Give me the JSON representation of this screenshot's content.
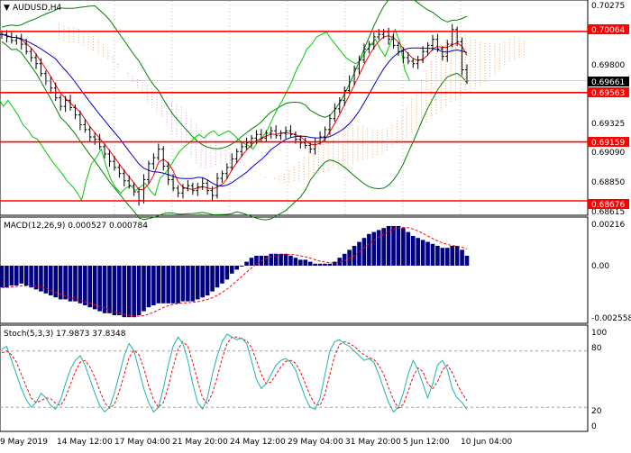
{
  "window": {
    "symbol_title": "AUDUSD,H4",
    "menu_arrow": "▼"
  },
  "colors": {
    "hline": "#ff0000",
    "price_bar": "#000000",
    "ma_fast": "#ff0000",
    "ma_slow": "#0000cc",
    "bollinger": "#008000",
    "cloud_a": "#f4a460",
    "cloud_b": "#d8a0e0",
    "chikou": "#00cc00",
    "macd_hist": "#000080",
    "macd_signal": "#ff0000",
    "stoch_main": "#20b2aa",
    "stoch_signal": "#ff0000",
    "grid": "#c0c0c0"
  },
  "price_panel": {
    "axis_labels": [
      "0.70275",
      "0.69800",
      "0.69325",
      "0.69090",
      "0.68850",
      "0.68615"
    ],
    "levels": [
      {
        "label": "0.70064",
        "value": 0.70064
      },
      {
        "label": "0.69563",
        "value": 0.69563
      },
      {
        "label": "0.69159",
        "value": 0.69159
      },
      {
        "label": "0.68676",
        "value": 0.68676
      }
    ],
    "current": {
      "label": "0.69661",
      "value": 0.69661
    }
  },
  "macd_panel": {
    "title": "MACD(12,26,9) 0.000527 0.000784",
    "axis_labels": [
      "0.00216",
      "0.00",
      "-0.002558"
    ]
  },
  "stoch_panel": {
    "title": "Stoch(5,3,3) 17.9873 37.8348",
    "axis_labels": [
      "100",
      "80",
      "20",
      "0"
    ]
  },
  "time_axis": {
    "labels": [
      "9 May 2019",
      "14 May 12:00",
      "17 May 04:00",
      "21 May 20:00",
      "24 May 12:00",
      "29 May 04:00",
      "31 May 20:00",
      "5 Jun 12:00",
      "10 Jun 04:00"
    ]
  },
  "chart_data": {
    "type": "candlestick",
    "title": "AUDUSD,H4",
    "y_range": [
      0.6858,
      0.703
    ],
    "close_series": [
      0.7004,
      0.7002,
      0.6999,
      0.7001,
      0.6996,
      0.699,
      0.6985,
      0.698,
      0.6972,
      0.6966,
      0.696,
      0.6952,
      0.6945,
      0.695,
      0.6944,
      0.6938,
      0.693,
      0.6926,
      0.692,
      0.6918,
      0.6912,
      0.6906,
      0.69,
      0.6895,
      0.689,
      0.6884,
      0.688,
      0.6875,
      0.6868,
      0.6885,
      0.6898,
      0.6903,
      0.691,
      0.6896,
      0.6885,
      0.6878,
      0.6874,
      0.6878,
      0.688,
      0.6876,
      0.6879,
      0.6882,
      0.6876,
      0.6872,
      0.6886,
      0.689,
      0.6895,
      0.6902,
      0.6908,
      0.6912,
      0.6915,
      0.6919,
      0.6922,
      0.6919,
      0.6923,
      0.6925,
      0.6921,
      0.6923,
      0.6925,
      0.6922,
      0.6918,
      0.6915,
      0.6913,
      0.691,
      0.6916,
      0.692,
      0.6926,
      0.6935,
      0.6943,
      0.695,
      0.6958,
      0.6966,
      0.6976,
      0.6983,
      0.6992,
      0.6996,
      0.7002,
      0.7004,
      0.7006,
      0.7,
      0.6995,
      0.699,
      0.6985,
      0.6982,
      0.698,
      0.6983,
      0.699,
      0.6995,
      0.7,
      0.6992,
      0.6986,
      0.6996,
      0.7008,
      0.6998,
      0.6975,
      0.6966
    ],
    "macd_hist": [
      -0.0011,
      -0.0011,
      -0.001,
      -0.001,
      -0.0009,
      -0.001,
      -0.0011,
      -0.0012,
      -0.0013,
      -0.0014,
      -0.0015,
      -0.0016,
      -0.0017,
      -0.0017,
      -0.0018,
      -0.0018,
      -0.0019,
      -0.002,
      -0.0021,
      -0.0022,
      -0.0023,
      -0.0024,
      -0.0024,
      -0.0025,
      -0.0025,
      -0.0026,
      -0.0026,
      -0.0026,
      -0.0025,
      -0.0023,
      -0.0021,
      -0.002,
      -0.0019,
      -0.0019,
      -0.0019,
      -0.0019,
      -0.0019,
      -0.0018,
      -0.0018,
      -0.0018,
      -0.0017,
      -0.0016,
      -0.0015,
      -0.0013,
      -0.0011,
      -0.0009,
      -0.0007,
      -0.0004,
      -0.0002,
      0.0,
      0.0002,
      0.0004,
      0.0005,
      0.0005,
      0.0005,
      0.0006,
      0.0006,
      0.0006,
      0.0006,
      0.0005,
      0.0004,
      0.0003,
      0.0003,
      0.0002,
      0.0001,
      0.0001,
      0.0001,
      0.0001,
      0.0002,
      0.0004,
      0.0006,
      0.0008,
      0.001,
      0.0012,
      0.0014,
      0.0016,
      0.0017,
      0.0018,
      0.0019,
      0.002,
      0.002,
      0.002,
      0.0019,
      0.0017,
      0.0015,
      0.0014,
      0.0013,
      0.0012,
      0.0011,
      0.001,
      0.0009,
      0.0009,
      0.001,
      0.001,
      0.0008,
      0.0005
    ],
    "stoch_main": [
      82,
      85,
      70,
      55,
      40,
      28,
      20,
      25,
      35,
      30,
      22,
      18,
      28,
      45,
      60,
      70,
      75,
      65,
      50,
      35,
      22,
      15,
      20,
      35,
      55,
      75,
      88,
      80,
      60,
      40,
      25,
      15,
      20,
      40,
      65,
      85,
      95,
      88,
      70,
      45,
      25,
      18,
      30,
      55,
      75,
      90,
      98,
      95,
      92,
      94,
      88,
      70,
      50,
      40,
      45,
      55,
      65,
      70,
      72,
      68,
      60,
      45,
      30,
      20,
      18,
      30,
      55,
      80,
      90,
      92,
      88,
      85,
      80,
      75,
      70,
      72,
      68,
      55,
      40,
      25,
      15,
      20,
      35,
      55,
      70,
      60,
      45,
      30,
      45,
      65,
      70,
      60,
      40,
      30,
      25,
      18
    ],
    "stoch_signal": [
      78,
      80,
      76,
      68,
      55,
      42,
      30,
      25,
      27,
      30,
      29,
      24,
      22,
      30,
      44,
      58,
      68,
      70,
      63,
      52,
      38,
      25,
      19,
      23,
      37,
      55,
      73,
      81,
      76,
      62,
      43,
      28,
      20,
      25,
      42,
      63,
      82,
      90,
      85,
      68,
      48,
      30,
      24,
      35,
      52,
      72,
      88,
      95,
      95,
      93,
      91,
      84,
      70,
      55,
      45,
      47,
      55,
      63,
      69,
      70,
      67,
      58,
      45,
      32,
      23,
      22,
      34,
      55,
      75,
      87,
      90,
      88,
      85,
      80,
      76,
      73,
      71,
      65,
      55,
      41,
      28,
      19,
      23,
      37,
      53,
      62,
      58,
      45,
      40,
      47,
      60,
      65,
      57,
      45,
      35,
      27
    ]
  }
}
